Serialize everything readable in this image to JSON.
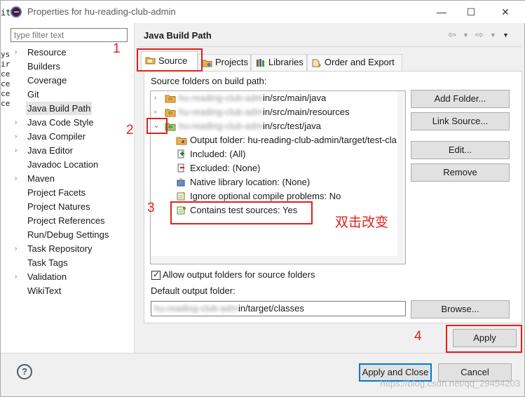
{
  "window": {
    "title": "Properties for hu-reading-club-admin",
    "controls": [
      "minimize",
      "maximize",
      "close"
    ]
  },
  "left_clipped_text": [
    "it",
    "ys",
    "ir",
    "ce",
    "ce",
    "ce",
    "ce"
  ],
  "filter": {
    "placeholder": "type filter text",
    "value": ""
  },
  "nav": {
    "items": [
      {
        "label": "Resource",
        "expandable": true
      },
      {
        "label": "Builders",
        "expandable": false
      },
      {
        "label": "Coverage",
        "expandable": false
      },
      {
        "label": "Git",
        "expandable": false
      },
      {
        "label": "Java Build Path",
        "expandable": false,
        "selected": true
      },
      {
        "label": "Java Code Style",
        "expandable": true
      },
      {
        "label": "Java Compiler",
        "expandable": true
      },
      {
        "label": "Java Editor",
        "expandable": true
      },
      {
        "label": "Javadoc Location",
        "expandable": false
      },
      {
        "label": "Maven",
        "expandable": true
      },
      {
        "label": "Project Facets",
        "expandable": false
      },
      {
        "label": "Project Natures",
        "expandable": false
      },
      {
        "label": "Project References",
        "expandable": false
      },
      {
        "label": "Run/Debug Settings",
        "expandable": false
      },
      {
        "label": "Task Repository",
        "expandable": true
      },
      {
        "label": "Task Tags",
        "expandable": false
      },
      {
        "label": "Validation",
        "expandable": true
      },
      {
        "label": "WikiText",
        "expandable": false
      }
    ]
  },
  "page": {
    "title": "Java Build Path"
  },
  "tabs": [
    {
      "label": "Source",
      "active": true,
      "icon": "source-folder-icon"
    },
    {
      "label": "Projects",
      "active": false,
      "icon": "projects-icon"
    },
    {
      "label": "Libraries",
      "active": false,
      "icon": "libraries-icon"
    },
    {
      "label": "Order and Export",
      "active": false,
      "icon": "order-export-icon"
    }
  ],
  "source": {
    "section_label": "Source folders on build path:",
    "tree": [
      {
        "text": "hu-reading-club-admin/src/main/java",
        "obscured_prefix": "hu-reading-club-adm",
        "visible_suffix": "in/src/main/java",
        "expanded": false
      },
      {
        "text": "hu-reading-club-admin/src/main/resources",
        "obscured_prefix": "hu-reading-club-adm",
        "visible_suffix": "in/src/main/resources",
        "expanded": false
      },
      {
        "text": "hu-reading-club-admin/src/test/java",
        "obscured_prefix": "hu-reading-club-adm",
        "visible_suffix": "in/src/test/java",
        "expanded": true
      }
    ],
    "children": [
      {
        "label": "Output folder: hu-reading-club-admin/target/test-cla",
        "icon": "output-folder-icon"
      },
      {
        "label": "Included: (All)",
        "icon": "included-icon"
      },
      {
        "label": "Excluded: (None)",
        "icon": "excluded-icon"
      },
      {
        "label": "Native library location: (None)",
        "icon": "native-library-icon"
      },
      {
        "label": "Ignore optional compile problems: No",
        "icon": "ignore-problems-icon"
      },
      {
        "label": "Contains test sources: Yes",
        "icon": "test-sources-icon"
      }
    ],
    "buttons": {
      "add_folder": "Add Folder...",
      "link_source": "Link Source...",
      "edit": "Edit...",
      "remove": "Remove",
      "browse": "Browse..."
    },
    "allow_output_label": "Allow output folders for source folders",
    "allow_output_checked": true,
    "default_output_label": "Default output folder:",
    "default_output": {
      "obscured_prefix": "hu-reading-club-adm",
      "visible_suffix": "in/target/classes"
    }
  },
  "actions": {
    "apply": "Apply",
    "apply_and_close": "Apply and Close",
    "cancel": "Cancel",
    "help_icon": "?"
  },
  "annotations": {
    "numbers": [
      "1",
      "2",
      "3",
      "4"
    ],
    "note": "双击改变",
    "color": "#e0211d"
  },
  "watermark": "https://blog.csdn.net/qq_29454203"
}
